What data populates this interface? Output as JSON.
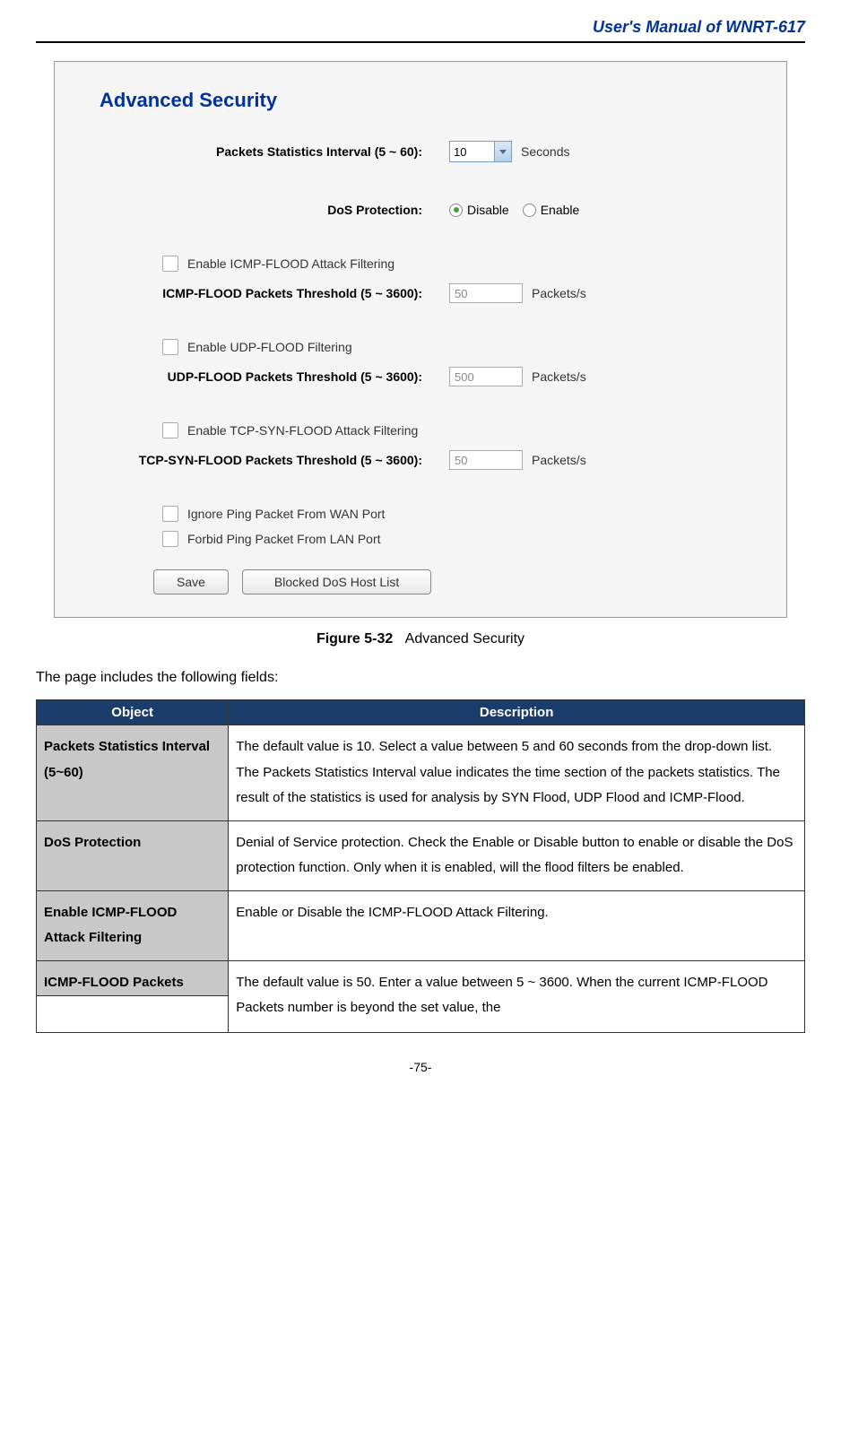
{
  "header": {
    "title": "User's Manual of WNRT-617"
  },
  "screenshot": {
    "title": "Advanced Security",
    "stats_interval": {
      "label": "Packets Statistics Interval (5 ~ 60):",
      "value": "10",
      "unit": "Seconds"
    },
    "dos_protection": {
      "label": "DoS Protection:",
      "option_disable": "Disable",
      "option_enable": "Enable"
    },
    "icmp": {
      "checkbox_label": "Enable ICMP-FLOOD Attack Filtering",
      "threshold_label": "ICMP-FLOOD Packets Threshold (5 ~ 3600):",
      "threshold_value": "50",
      "unit": "Packets/s"
    },
    "udp": {
      "checkbox_label": "Enable UDP-FLOOD Filtering",
      "threshold_label": "UDP-FLOOD Packets Threshold (5 ~ 3600):",
      "threshold_value": "500",
      "unit": "Packets/s"
    },
    "tcp": {
      "checkbox_label": "Enable TCP-SYN-FLOOD Attack Filtering",
      "threshold_label": "TCP-SYN-FLOOD Packets Threshold (5 ~ 3600):",
      "threshold_value": "50",
      "unit": "Packets/s"
    },
    "ping": {
      "ignore_wan": "Ignore Ping Packet From WAN Port",
      "forbid_lan": "Forbid Ping Packet From LAN Port"
    },
    "buttons": {
      "save": "Save",
      "blocked": "Blocked DoS Host List"
    }
  },
  "figure": {
    "number": "Figure 5-32",
    "caption": "Advanced Security"
  },
  "intro_text": "The page includes the following fields:",
  "table": {
    "header_object": "Object",
    "header_description": "Description",
    "rows": [
      {
        "object": "Packets Statistics Interval (5~60)",
        "description": "The default value is 10. Select a value between 5 and 60 seconds from the drop-down list. The Packets Statistics Interval value indicates the time section of the packets statistics. The result of the statistics is used for analysis by SYN Flood, UDP Flood and ICMP-Flood."
      },
      {
        "object": "DoS Protection",
        "description": "Denial of Service protection. Check the Enable or Disable button to enable or disable the DoS protection function. Only when it is enabled, will the flood filters be enabled."
      },
      {
        "object": "Enable ICMP-FLOOD Attack Filtering",
        "description": "Enable or Disable the ICMP-FLOOD Attack Filtering."
      },
      {
        "object": "ICMP-FLOOD Packets",
        "description": "The default value is 50. Enter a value between 5 ~ 3600. When the current ICMP-FLOOD Packets number is beyond the set value, the"
      }
    ]
  },
  "page_number": "-75-"
}
